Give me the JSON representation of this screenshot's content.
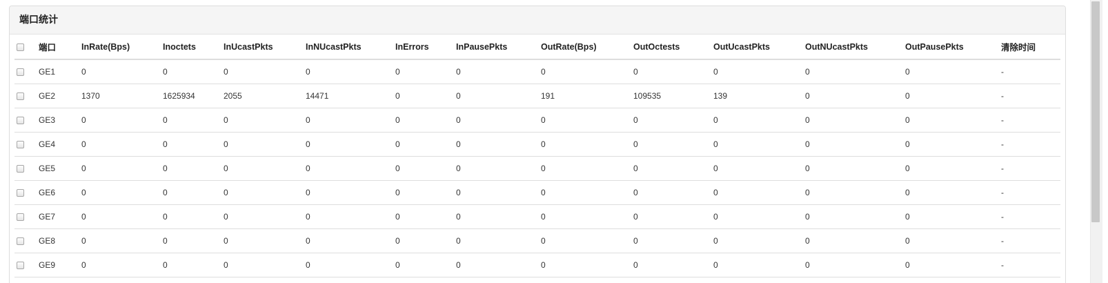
{
  "panel": {
    "title": "端口统计"
  },
  "table": {
    "headers": [
      "端口",
      "InRate(Bps)",
      "Inoctets",
      "InUcastPkts",
      "InNUcastPkts",
      "InErrors",
      "InPausePkts",
      "OutRate(Bps)",
      "OutOctests",
      "OutUcastPkts",
      "OutNUcastPkts",
      "OutPausePkts",
      "清除时间"
    ],
    "rows": [
      [
        "GE1",
        "0",
        "0",
        "0",
        "0",
        "0",
        "0",
        "0",
        "0",
        "0",
        "0",
        "0",
        "-"
      ],
      [
        "GE2",
        "1370",
        "1625934",
        "2055",
        "14471",
        "0",
        "0",
        "191",
        "109535",
        "139",
        "0",
        "0",
        "-"
      ],
      [
        "GE3",
        "0",
        "0",
        "0",
        "0",
        "0",
        "0",
        "0",
        "0",
        "0",
        "0",
        "0",
        "-"
      ],
      [
        "GE4",
        "0",
        "0",
        "0",
        "0",
        "0",
        "0",
        "0",
        "0",
        "0",
        "0",
        "0",
        "-"
      ],
      [
        "GE5",
        "0",
        "0",
        "0",
        "0",
        "0",
        "0",
        "0",
        "0",
        "0",
        "0",
        "0",
        "-"
      ],
      [
        "GE6",
        "0",
        "0",
        "0",
        "0",
        "0",
        "0",
        "0",
        "0",
        "0",
        "0",
        "0",
        "-"
      ],
      [
        "GE7",
        "0",
        "0",
        "0",
        "0",
        "0",
        "0",
        "0",
        "0",
        "0",
        "0",
        "0",
        "-"
      ],
      [
        "GE8",
        "0",
        "0",
        "0",
        "0",
        "0",
        "0",
        "0",
        "0",
        "0",
        "0",
        "0",
        "-"
      ],
      [
        "GE9",
        "0",
        "0",
        "0",
        "0",
        "0",
        "0",
        "0",
        "0",
        "0",
        "0",
        "0",
        "-"
      ]
    ]
  },
  "icons": {
    "checkbox": "checkbox-icon",
    "scrollbar": "vertical-scrollbar"
  }
}
